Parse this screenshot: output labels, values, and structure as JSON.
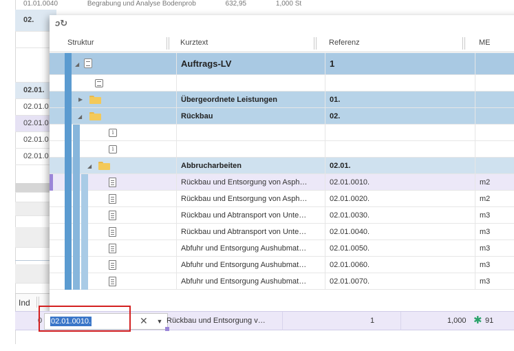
{
  "background": {
    "top_row": [
      "01.01.0040",
      "Begrabung und Analyse Bodenprob",
      "632,95",
      "1,000 St"
    ],
    "rows": [
      {
        "label": "02.",
        "style": "blue-bold"
      },
      {
        "label": "",
        "style": "plain"
      },
      {
        "label": "",
        "style": "plain"
      },
      {
        "label": "02.01.",
        "style": "blue-bold"
      },
      {
        "label": "02.01.0",
        "style": "plain"
      },
      {
        "label": "02.01.0",
        "style": "lilac"
      },
      {
        "label": "02.01.0",
        "style": "plain"
      },
      {
        "label": "02.01.0",
        "style": "plain"
      }
    ],
    "column_header_ind": "Ind"
  },
  "popup": {
    "sync_icon": "sync-icon",
    "columns": {
      "struktur": "Struktur",
      "kurztext": "Kurztext",
      "referenz": "Referenz",
      "me": "ME"
    },
    "rows": [
      {
        "kind": "lv",
        "kurztext": "Auftrags-LV",
        "referenz": "1",
        "me": ""
      },
      {
        "kind": "note",
        "kurztext": "",
        "referenz": "",
        "me": ""
      },
      {
        "kind": "folder-collapsed",
        "kurztext": "Übergeordnete Leistungen",
        "referenz": "01.",
        "me": ""
      },
      {
        "kind": "folder-expanded",
        "kurztext": "Rückbau",
        "referenz": "02.",
        "me": ""
      },
      {
        "kind": "info",
        "kurztext": "",
        "referenz": "",
        "me": ""
      },
      {
        "kind": "info",
        "kurztext": "",
        "referenz": "",
        "me": ""
      },
      {
        "kind": "subfolder",
        "kurztext": "Abbrucharbeiten",
        "referenz": "02.01.",
        "me": ""
      },
      {
        "kind": "position-selected",
        "kurztext": "Rückbau und Entsorgung von Asph…",
        "referenz": "02.01.0010.",
        "me": "m2"
      },
      {
        "kind": "position",
        "kurztext": "Rückbau und Entsorgung von Asph…",
        "referenz": "02.01.0020.",
        "me": "m2"
      },
      {
        "kind": "position",
        "kurztext": "Rückbau und Abtransport von Unte…",
        "referenz": "02.01.0030.",
        "me": "m3"
      },
      {
        "kind": "position",
        "kurztext": "Rückbau und Abtransport von Unte…",
        "referenz": "02.01.0040.",
        "me": "m3"
      },
      {
        "kind": "position",
        "kurztext": "Abfuhr und Entsorgung Aushubmat…",
        "referenz": "02.01.0050.",
        "me": "m3"
      },
      {
        "kind": "position",
        "kurztext": "Abfuhr und Entsorgung Aushubmat…",
        "referenz": "02.01.0060.",
        "me": "m3"
      },
      {
        "kind": "position",
        "kurztext": "Abfuhr und Entsorgung Aushubmat…",
        "referenz": "02.01.0070.",
        "me": "m3"
      }
    ]
  },
  "editor_row": {
    "prefix": "0",
    "input_value": "02.01.0010.",
    "clear_glyph": "✕",
    "dropdown_glyph": "▼",
    "description": "Rückbau und Entsorgung v…",
    "count": "1",
    "quantity": "1,000",
    "star_glyph": "✱",
    "number": "91"
  },
  "colors": {
    "highlight": "#d32020",
    "selection_text": "#3a76c8",
    "lv_row": "#a9c9e3",
    "selected_row": "#ece8f8"
  }
}
